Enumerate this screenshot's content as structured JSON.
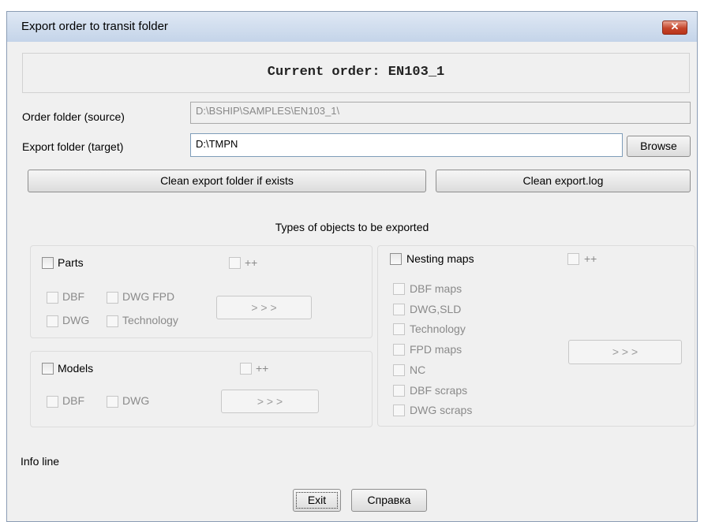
{
  "window": {
    "title": "Export order to transit folder"
  },
  "header": {
    "current_order": "Current order: EN103_1"
  },
  "order_folder": {
    "label": "Order folder (source)",
    "value": "D:\\BSHIP\\SAMPLES\\EN103_1\\"
  },
  "export_folder": {
    "label": "Export folder (target)",
    "value": "D:\\TMPN",
    "browse": "Browse"
  },
  "actions": {
    "clean_folder": "Clean export folder if exists",
    "clean_log": "Clean export.log"
  },
  "types_title": "Types of objects to be exported",
  "parts": {
    "title": "Parts",
    "plusplus": "++",
    "dbf": "DBF",
    "dwg_fpd": "DWG FPD",
    "dwg": "DWG",
    "technology": "Technology",
    "more": "> > >"
  },
  "models": {
    "title": "Models",
    "plusplus": "++",
    "dbf": "DBF",
    "dwg": "DWG",
    "more": "> > >"
  },
  "nesting": {
    "title": "Nesting maps",
    "plusplus": "++",
    "items": [
      "DBF maps",
      "DWG,SLD",
      "Technology",
      "FPD maps",
      "NC",
      "DBF scraps",
      "DWG scraps"
    ],
    "more": "> > >"
  },
  "info_line": "Info line",
  "footer": {
    "exit": "Exit",
    "help": "Справка"
  }
}
